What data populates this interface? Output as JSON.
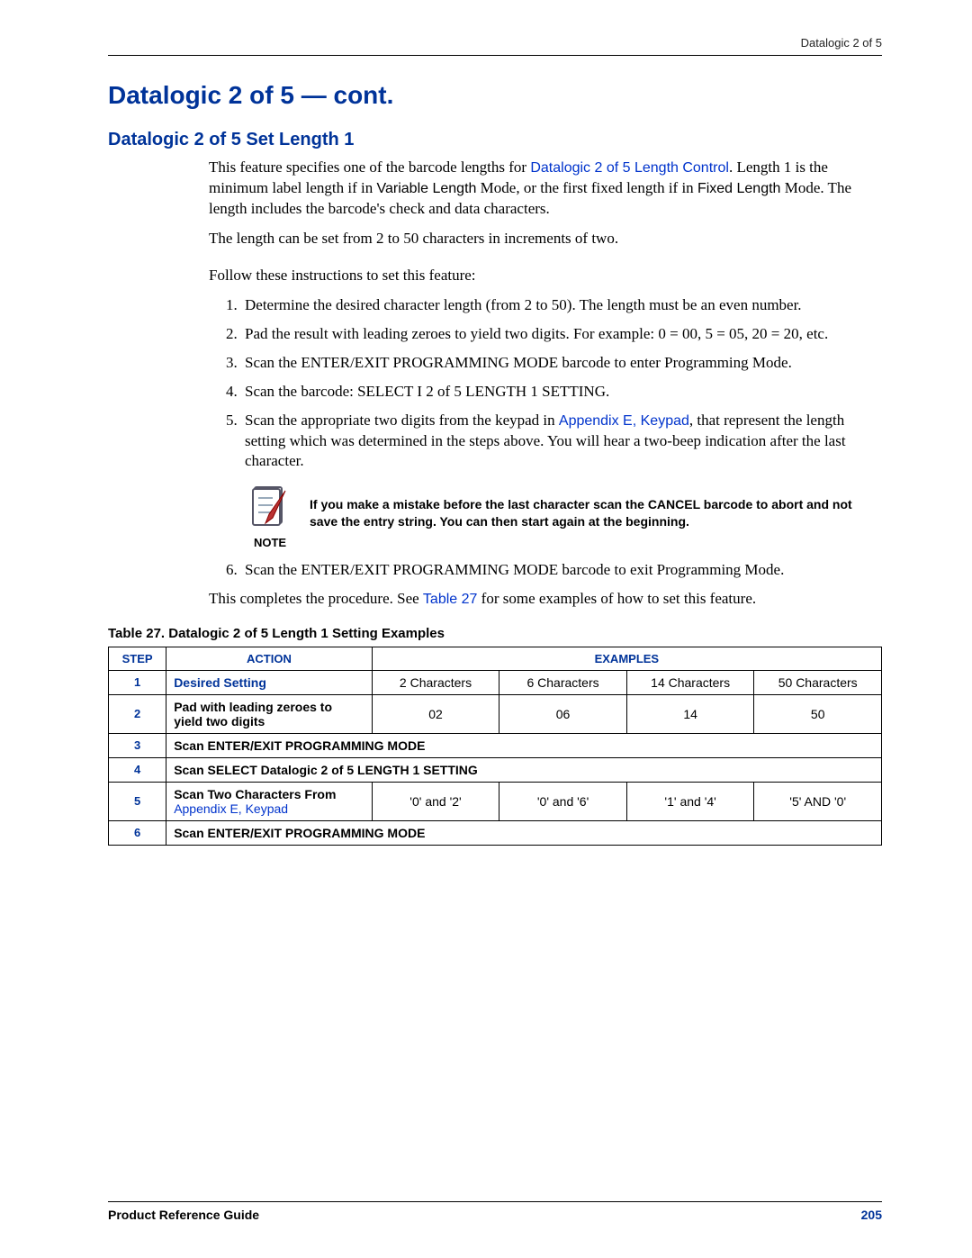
{
  "header": {
    "section": "Datalogic 2 of 5"
  },
  "title": "Datalogic 2 of 5 — cont.",
  "subhead": "Datalogic 2 of 5 Set Length 1",
  "para1_a": "This feature specifies one of the barcode lengths for ",
  "para1_link1": "Datalogic 2 of 5 Length Control",
  "para1_b": ". Length 1 is the minimum label length if in ",
  "para1_sans1": "Variable Length",
  "para1_c": " Mode, or the first fixed length if in ",
  "para1_sans2": "Fixed Length",
  "para1_d": " Mode. The length includes the barcode's check and data characters.",
  "para2": "The length can be set from 2 to 50 characters in increments of two.",
  "para3": "Follow these instructions to set this feature:",
  "steps": {
    "s1": "Determine the desired character length (from 2 to 50). The length must be an even number.",
    "s2": "Pad the result with leading zeroes to yield two digits. For example: 0 = 00, 5 = 05, 20 = 20, etc.",
    "s3": "Scan the ENTER/EXIT PROGRAMMING MODE barcode to enter Programming Mode.",
    "s4": "Scan the barcode: SELECT I 2 of 5 LENGTH 1 SETTING.",
    "s5a": "Scan the appropriate two digits from the keypad in ",
    "s5link": "Appendix E, Keypad",
    "s5b": ", that represent the length setting which was determined in the steps above. You will hear a two-beep indication after the last character.",
    "s6": "Scan the ENTER/EXIT PROGRAMMING MODE barcode to exit Programming Mode."
  },
  "note": {
    "label": "NOTE",
    "text": "If you make a mistake before the last character scan the CANCEL barcode to abort and not save the entry string. You can then start again at the beginning."
  },
  "closing_a": "This completes the procedure. See ",
  "closing_link": "Table 27",
  "closing_b": " for some examples of how to set this feature.",
  "table_caption": "Table 27. Datalogic 2 of 5 Length 1 Setting Examples",
  "table": {
    "head": {
      "step": "STEP",
      "action": "ACTION",
      "examples": "EXAMPLES"
    },
    "rows": [
      {
        "step": "1",
        "action": "Desired Setting",
        "ex": [
          "2 Characters",
          "6 Characters",
          "14 Characters",
          "50 Characters"
        ]
      },
      {
        "step": "2",
        "action": "Pad with leading zeroes to yield two digits",
        "ex": [
          "02",
          "06",
          "14",
          "50"
        ]
      },
      {
        "step": "3",
        "action_full": "Scan ENTER/EXIT PROGRAMMING MODE"
      },
      {
        "step": "4",
        "action_full": "Scan SELECT Datalogic 2 of 5 LENGTH 1 SETTING"
      },
      {
        "step": "5",
        "action": "Scan Two Characters From ",
        "action_link": "Appendix E, Keypad",
        "ex": [
          "'0' and '2'",
          "'0' and '6'",
          "'1' and '4'",
          "'5' AND '0'"
        ]
      },
      {
        "step": "6",
        "action_full": "Scan ENTER/EXIT PROGRAMMING MODE"
      }
    ]
  },
  "footer": {
    "guide": "Product Reference Guide",
    "page": "205"
  }
}
